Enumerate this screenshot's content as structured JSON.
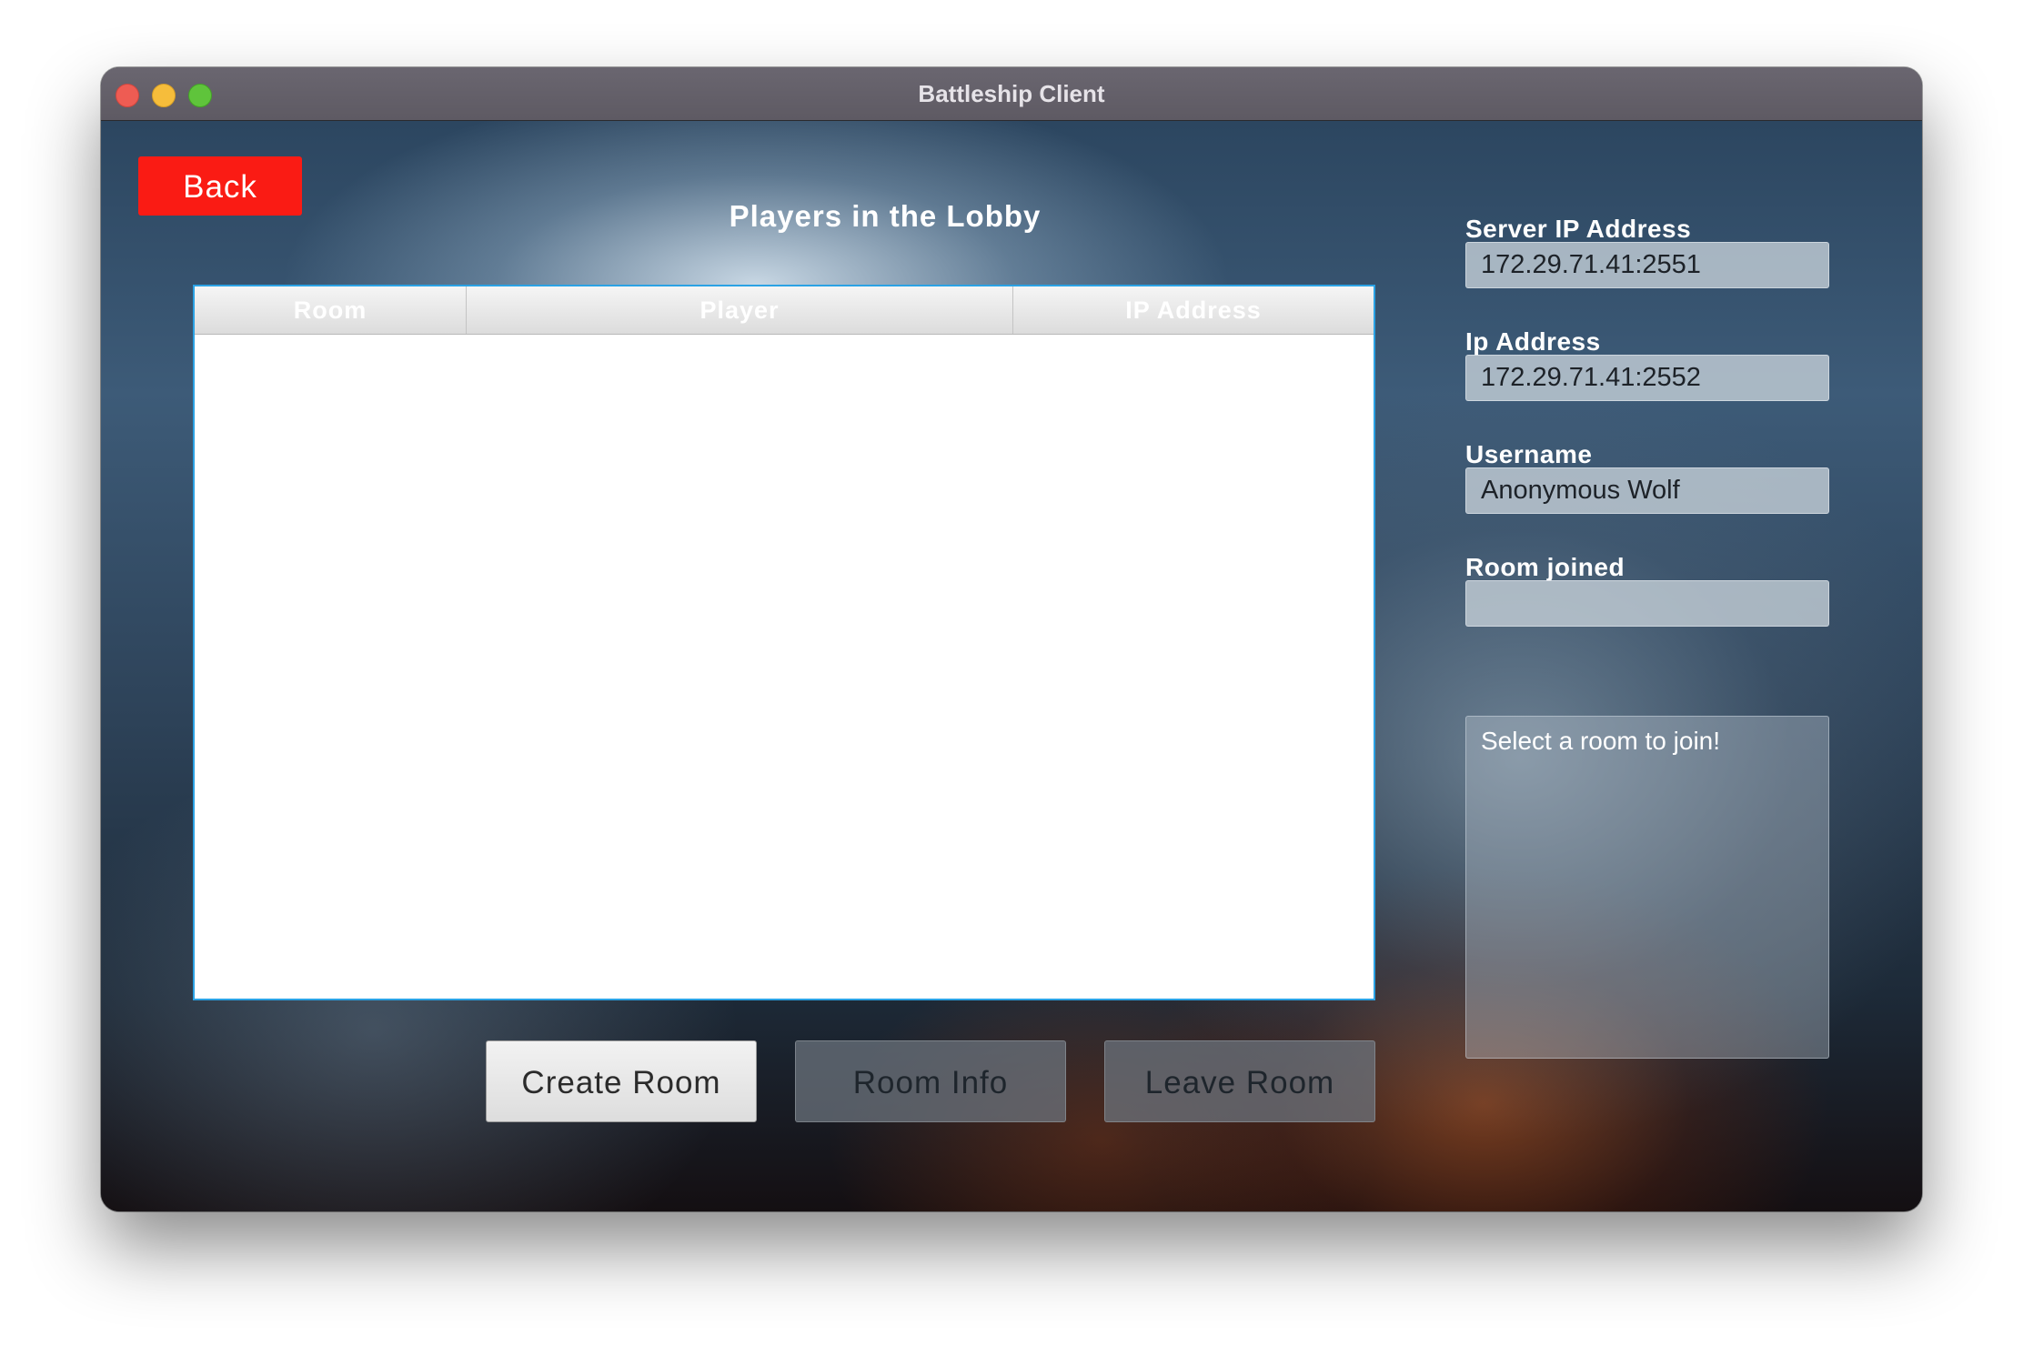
{
  "window": {
    "title": "Battleship Client"
  },
  "toolbar": {
    "back_label": "Back"
  },
  "lobby": {
    "title": "Players in the Lobby",
    "columns": [
      "Room",
      "Player",
      "IP Address"
    ],
    "rows": []
  },
  "actions": {
    "create_room": "Create Room",
    "room_info": "Room Info",
    "leave_room": "Leave Room"
  },
  "fields": {
    "server_ip": {
      "label": "Server IP Address",
      "value": "172.29.71.41:2551"
    },
    "ip_address": {
      "label": "Ip Address",
      "value": "172.29.71.41:2552"
    },
    "username": {
      "label": "Username",
      "value": "Anonymous Wolf"
    },
    "room_joined": {
      "label": "Room joined",
      "value": ""
    }
  },
  "message": {
    "text": "Select a room to join!"
  },
  "colors": {
    "back_button": "#fa1b14",
    "table_border": "#2ba2e4",
    "close": "#ee5c53",
    "minimize": "#f6bd3b",
    "maximize": "#5fc43b"
  }
}
